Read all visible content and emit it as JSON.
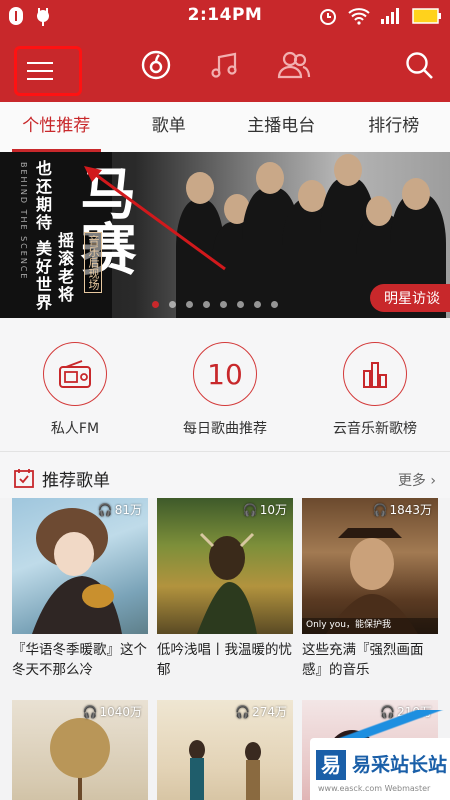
{
  "status_bar": {
    "time": "2:14PM"
  },
  "header": {
    "icons": [
      "menu-icon",
      "music-disc-icon",
      "music-note-icon",
      "friends-icon",
      "search-icon"
    ]
  },
  "tabs": [
    {
      "label": "个性推荐",
      "active": true
    },
    {
      "label": "歌单",
      "active": false
    },
    {
      "label": "主播电台",
      "active": false
    },
    {
      "label": "排行榜",
      "active": false
    }
  ],
  "banner": {
    "side_text": "BEHIND THE SCENCE",
    "poem_col1": "也还期待",
    "poem_col1b": "美好世界",
    "poem_col2": "摇滚老将",
    "title": "马赛",
    "live_tag": "音乐后现场",
    "badge": "明星访谈",
    "slide_count": 8,
    "active_slide": 1
  },
  "quick_links": [
    {
      "label": "私人FM",
      "icon": "radio-icon"
    },
    {
      "label": "每日歌曲推荐",
      "icon": "calendar-10-icon",
      "number": "10"
    },
    {
      "label": "云音乐新歌榜",
      "icon": "chart-bars-icon"
    }
  ],
  "recommend": {
    "title": "推荐歌单",
    "more": "更多",
    "playlists": [
      {
        "count": "81万",
        "desc": "『华语冬季暖歌』这个冬天不那么冷"
      },
      {
        "count": "10万",
        "desc": "低吟浅唱丨我温暖的忧郁"
      },
      {
        "count": "1843万",
        "desc": "这些充满『强烈画面感』的音乐",
        "caption": "Only you，能保护我"
      },
      {
        "count": "1040万",
        "desc": ""
      },
      {
        "count": "274万",
        "desc": ""
      },
      {
        "count": "210万",
        "desc": ""
      }
    ]
  },
  "watermark": {
    "logo": "易",
    "text": "易采站长站",
    "url": "www.easck.com  Webmaster"
  },
  "colors": {
    "brand": "#c8282b",
    "highlight_box": "#ff1212"
  }
}
